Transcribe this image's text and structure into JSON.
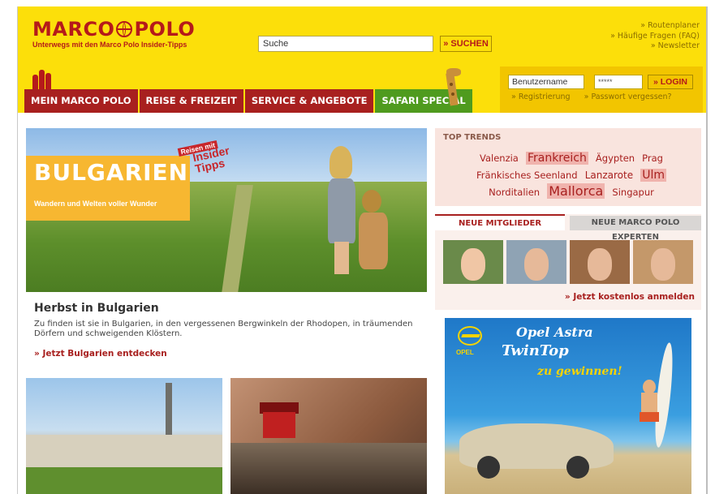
{
  "header": {
    "logo_text_left": "MARCO",
    "logo_text_right": "POLO",
    "tagline": "Unterwegs mit den Marco Polo Insider-Tipps",
    "search": {
      "placeholder": "Suche",
      "value": "Suche",
      "button_label": "» SUCHEN"
    },
    "top_links": [
      "» Routenplaner",
      "» Häufige Fragen (FAQ)",
      "» Newsletter"
    ],
    "nav": [
      {
        "label": "MEIN MARCO POLO"
      },
      {
        "label": "REISE & FREIZEIT"
      },
      {
        "label": "SERVICE & ANGEBOTE"
      },
      {
        "label": "SAFARI SPECIAL"
      }
    ],
    "login": {
      "username_value": "Benutzername",
      "password_value": "*****",
      "button_label": "» LOGIN",
      "register_link": "» Registrierung",
      "forgot_link": "» Passwort vergessen?"
    }
  },
  "hero": {
    "title": "BULGARIEN",
    "subtitle": "Wandern und Welten voller Wunder",
    "badge_small": "Reisen mit",
    "badge_big_1": "Insider",
    "badge_big_2": "Tipps"
  },
  "article": {
    "title": "Herbst in Bulgarien",
    "body": "Zu finden ist sie in Bulgarien, in den vergessenen Bergwinkeln der Rhodopen, in träumenden Dörfern und schweigenden Klöstern.",
    "link": "» Jetzt Bulgarien entdecken"
  },
  "trends": {
    "heading": "TOP TRENDS",
    "tags": [
      {
        "label": "Valenzia",
        "size": "s"
      },
      {
        "label": "Frankreich",
        "size": "l"
      },
      {
        "label": "Ägypten",
        "size": "s"
      },
      {
        "label": "Prag",
        "size": "s"
      },
      {
        "label": "Fränkisches Seenland",
        "size": "s"
      },
      {
        "label": "Lanzarote",
        "size": "m"
      },
      {
        "label": "Ulm",
        "size": "l"
      },
      {
        "label": "Norditalien",
        "size": "s"
      },
      {
        "label": "Mallorca",
        "size": "xl"
      },
      {
        "label": "Singapur",
        "size": "s"
      }
    ]
  },
  "members": {
    "tab_members": "NEUE MITGLIEDER",
    "tab_experts": "NEUE MARCO POLO EXPERTEN",
    "link": "» Jetzt kostenlos anmelden"
  },
  "ad": {
    "brand": "OPEL",
    "title_1": "Opel Astra",
    "title_2": "TwinTop",
    "title_3": "zu gewinnen!"
  },
  "colors": {
    "header_yellow": "#fcdf0a",
    "brand_red": "#a8201f",
    "safari_green": "#4f9b1e"
  }
}
